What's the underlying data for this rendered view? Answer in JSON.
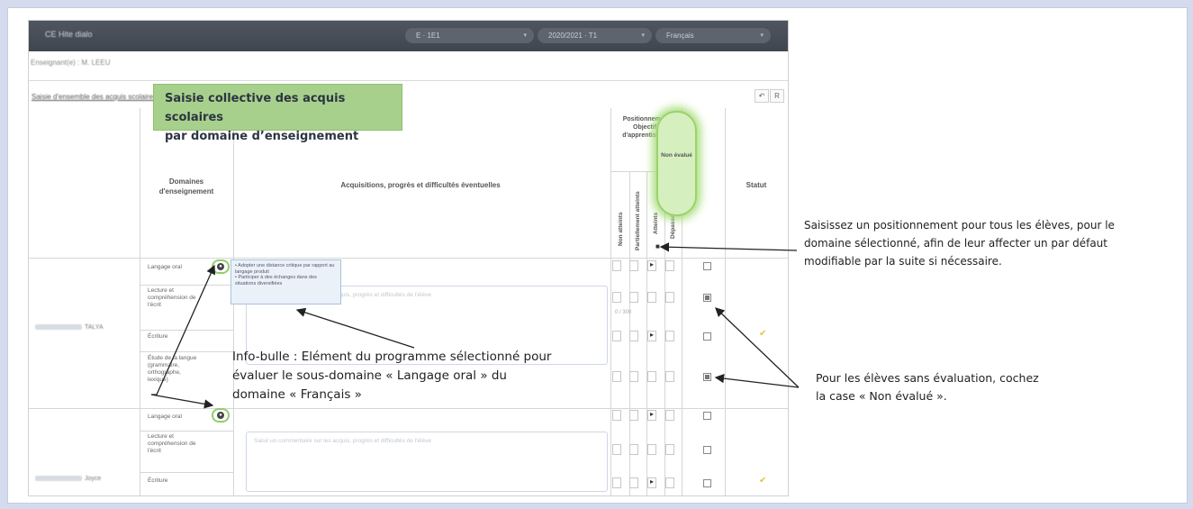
{
  "topbar": {
    "title": "CE Hite dialo",
    "selects": [
      {
        "value": "E · 1E1"
      },
      {
        "value": "2020/2021 · T1"
      },
      {
        "value": "Français"
      }
    ]
  },
  "teacher_label": "Enseignant(e) : M. LEEU",
  "panel": {
    "title": "Saisie d'ensemble des acquis scolaires",
    "buttons": [
      "↶",
      "R"
    ]
  },
  "banner": {
    "line1": "Saisie collective des acquis scolaires",
    "line2": "par domaine d’enseignement"
  },
  "headers": {
    "domaines": "Domaines d'enseignement",
    "acquisitions": "Acquisitions, progrès et difficultés éventuelles",
    "positionnement": "Positionnement Objectifs d'apprentissage",
    "levels": [
      "Non atteints",
      "Partiellement atteints",
      "Atteints",
      "Dépassés"
    ],
    "non_evalue": "Non évalué",
    "statut": "Statut"
  },
  "students": [
    {
      "name": "TALYA",
      "domains": [
        "Langage oral",
        "Lecture et compréhension de l'écrit",
        "Écriture",
        "Étude de la langue (grammaire, orthographe, lexique)"
      ],
      "comment_placeholder": "Saisir un commentaire sur les acquis, progrès et difficultés de l'élève",
      "counter": "0 / 300"
    },
    {
      "name": "Joyce",
      "domains": [
        "Langage oral",
        "Lecture et compréhension de l'écrit",
        "Écriture"
      ],
      "comment_placeholder": "Saisir un commentaire sur les acquis, progrès et difficultés de l'élève"
    }
  ],
  "tooltip": {
    "items": [
      "Adopter une distance critique par rapport au langage produit",
      "Participer à des échanges dans des situations diversifiées"
    ]
  },
  "annotations": {
    "positionnement": "Saisissez un positionnement pour tous les élèves, pour le domaine sélectionné, afin de leur affecter un par défaut modifiable par la suite si nécessaire.",
    "non_evalue": "Pour les élèves sans évaluation, cochez la case « Non évalué ».",
    "infobulle": "Info-bulle : Elément du programme sélectionné pour évaluer le sous-domaine « Langage oral » du domaine « Français »"
  },
  "colors": {
    "background": "#d4dbee",
    "topbar": "#464c55",
    "banner": "#a8d08d",
    "highlight_green": "#9bd36b",
    "status_tick": "#e6c440"
  }
}
